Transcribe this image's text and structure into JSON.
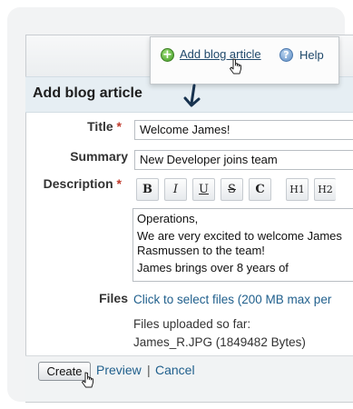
{
  "topbar": {
    "add_link": "Add blog article",
    "add_icon": "plus-circle-icon",
    "help_link": "Help",
    "help_icon": "question-circle-icon"
  },
  "form": {
    "heading": "Add blog article",
    "required_marker": "*",
    "title_label": "Title",
    "title_value": "Welcome James!",
    "summary_label": "Summary",
    "summary_value": "New Developer joins team",
    "description_label": "Description",
    "toolbar": {
      "bold": "B",
      "italic": "I",
      "underline": "U",
      "strike": "S",
      "clear": "C",
      "h1": "H1",
      "h2": "H2"
    },
    "description_paragraphs": [
      "Operations,",
      "We are very excited to welcome James Rasmussen to the team!",
      "James brings over 8 years of"
    ],
    "files_label": "Files",
    "files_link": "Click to select files (200 MB max per",
    "files_uploaded_label": "Files uploaded so far:",
    "uploaded_file": "James_R.JPG (1849482 Bytes)"
  },
  "actions": {
    "create": "Create",
    "preview": "Preview",
    "separator": "|",
    "cancel": "Cancel"
  },
  "colors": {
    "link": "#21608d",
    "required": "#c0392b",
    "header_band": "#e6eef3"
  }
}
